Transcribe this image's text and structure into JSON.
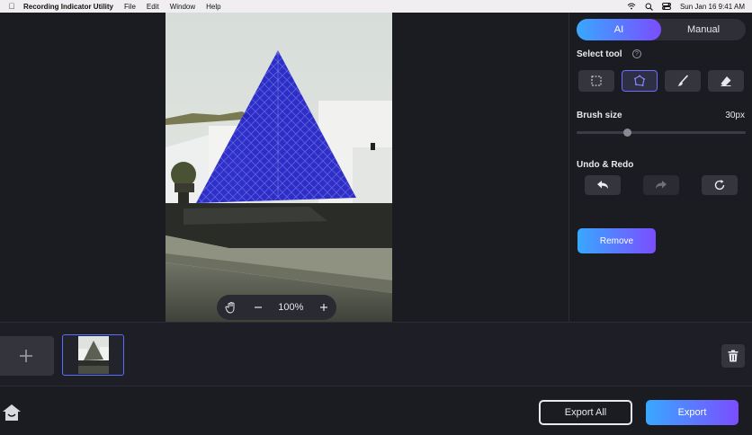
{
  "menubar": {
    "app_name": "Recording Indicator Utility",
    "menus": [
      "File",
      "Edit",
      "Window",
      "Help"
    ],
    "datetime": "Sun Jan 16  9:41 AM"
  },
  "canvas": {
    "zoom_label": "100%"
  },
  "panel": {
    "mode_tabs": [
      "AI",
      "Manual"
    ],
    "active_mode": "AI",
    "select_tool_label": "Select tool",
    "tools": [
      "rect-select",
      "lasso-select",
      "brush",
      "eraser"
    ],
    "active_tool": "lasso-select",
    "brush_size_label": "Brush size",
    "brush_size_value": "30px",
    "brush_size_fraction": 0.3,
    "undo_redo_label": "Undo & Redo",
    "remove_label": "Remove"
  },
  "colors": {
    "accent_start": "#38a8ff",
    "accent_end": "#7b4dff",
    "mask_overlay": "#2020c8"
  },
  "footer": {
    "export_all_label": "Export All",
    "export_label": "Export"
  }
}
